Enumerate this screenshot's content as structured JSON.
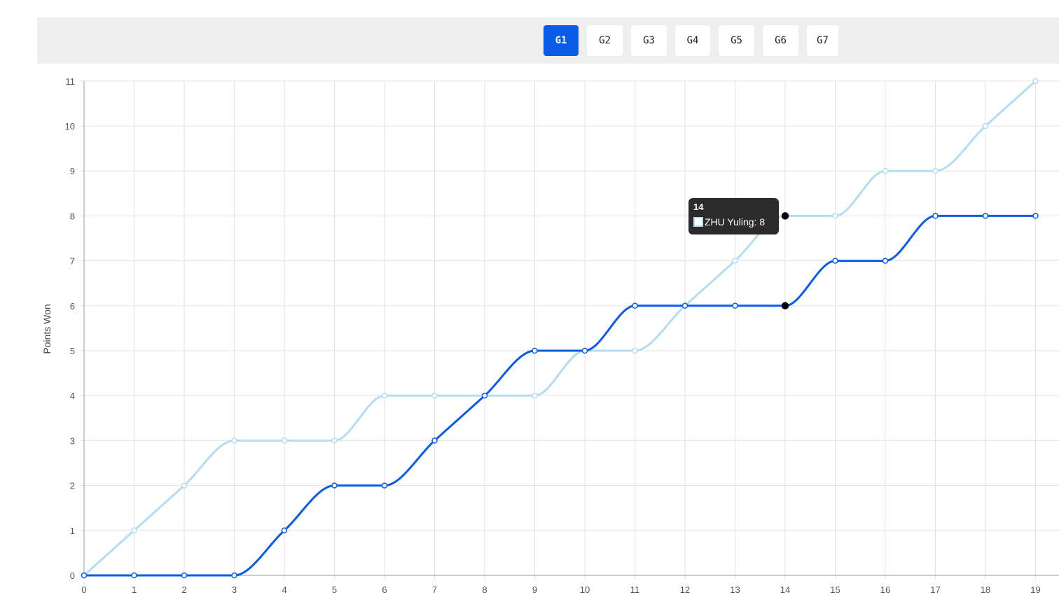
{
  "tabs": [
    {
      "label": "G1",
      "active": true
    },
    {
      "label": "G2",
      "active": false
    },
    {
      "label": "G3",
      "active": false
    },
    {
      "label": "G4",
      "active": false
    },
    {
      "label": "G5",
      "active": false
    },
    {
      "label": "G6",
      "active": false
    },
    {
      "label": "G7",
      "active": false
    }
  ],
  "tooltip": {
    "title": "14",
    "label": "ZHU Yuling: 8",
    "swatch_color": "#b4dcf5"
  },
  "chart_data": {
    "type": "line",
    "ylabel": "Points Won",
    "xlabel": "",
    "x": [
      0,
      1,
      2,
      3,
      4,
      5,
      6,
      7,
      8,
      9,
      10,
      11,
      12,
      13,
      14,
      15,
      16,
      17,
      18,
      19
    ],
    "xlim": [
      0,
      19
    ],
    "ylim": [
      0,
      11
    ],
    "grid": true,
    "series": [
      {
        "name": "ZHU Yuling",
        "color": "#b4dcf5",
        "values": [
          0,
          1,
          2,
          3,
          3,
          3,
          4,
          4,
          4,
          4,
          5,
          5,
          6,
          7,
          8,
          8,
          9,
          9,
          10,
          11
        ]
      },
      {
        "name": "",
        "color": "#0a5ce6",
        "values": [
          0,
          0,
          0,
          0,
          1,
          2,
          2,
          3,
          4,
          5,
          5,
          6,
          6,
          6,
          6,
          7,
          7,
          8,
          8,
          8
        ]
      }
    ],
    "highlight_x": 14
  }
}
